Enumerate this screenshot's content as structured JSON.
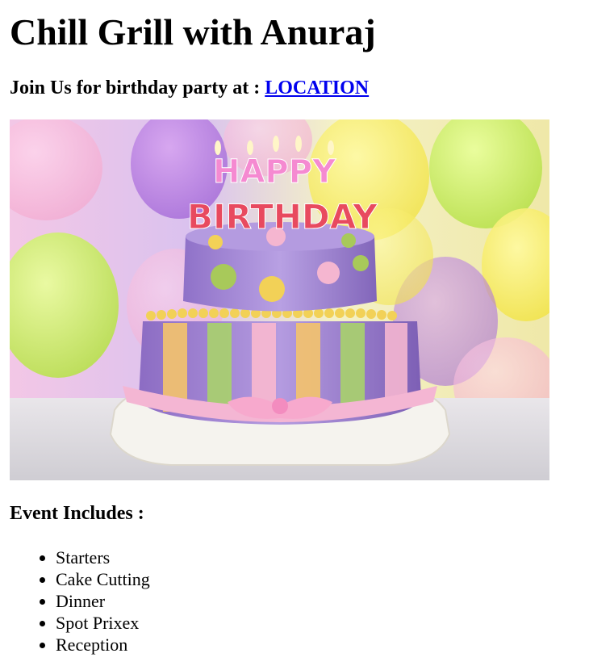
{
  "page": {
    "title": "Chill Grill with Anuraj",
    "invite_text": "Join Us for birthday party at : ",
    "location_link": "LOCATION"
  },
  "hero_image": {
    "alt": "HAPPY BIRTHDAY",
    "candle_text_top": "HAPPY",
    "candle_text_bottom": "BIRTHDAY"
  },
  "event": {
    "heading": "Event Includes :",
    "items": [
      "Starters",
      "Cake Cutting",
      "Dinner",
      "Spot Prixex",
      "Reception"
    ]
  }
}
